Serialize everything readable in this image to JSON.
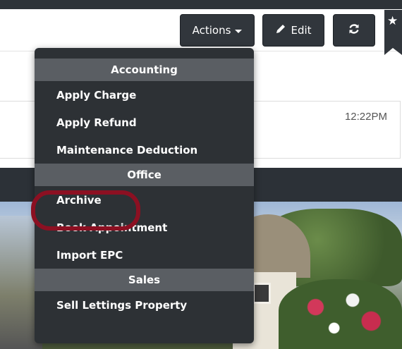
{
  "toolbar": {
    "actions_label": "Actions",
    "edit_label": "Edit"
  },
  "card": {
    "time": "12:22PM"
  },
  "actions_menu": {
    "sections": [
      {
        "header": "Accounting",
        "items": [
          "Apply Charge",
          "Apply Refund",
          "Maintenance Deduction"
        ]
      },
      {
        "header": "Office",
        "items": [
          "Archive",
          "Book Appointment",
          "Import EPC"
        ]
      },
      {
        "header": "Sales",
        "items": [
          "Sell Lettings Property"
        ]
      }
    ]
  },
  "icons": {
    "edit": "pencil-icon",
    "refresh": "refresh-icon",
    "bookmark": "star-bookmark-icon"
  },
  "colors": {
    "highlight_ring": "#8c1022",
    "menu_background": "#2d3135",
    "menu_header": "#5a5e63"
  }
}
